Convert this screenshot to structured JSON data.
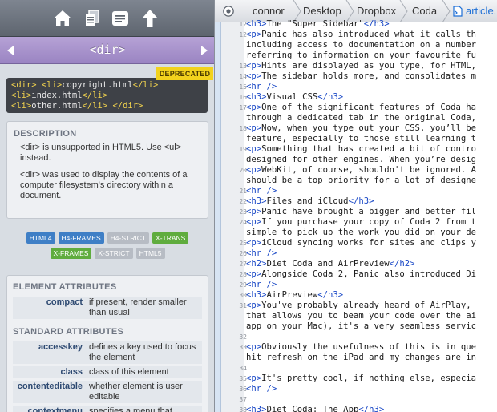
{
  "sidebar": {
    "toolbar": [
      "home-icon",
      "copy-icon",
      "list-icon",
      "up-arrow-icon"
    ],
    "title": "<dir>",
    "badge": "DEPRECATED",
    "example_lines": [
      [
        {
          "t": "tag",
          "v": "<dir>"
        },
        {
          "t": "txt",
          "v": " "
        },
        {
          "t": "tag",
          "v": "<li>"
        },
        {
          "t": "txt",
          "v": "copyright.html"
        },
        {
          "t": "tag",
          "v": "</li>"
        }
      ],
      [
        {
          "t": "tag",
          "v": "<li>"
        },
        {
          "t": "txt",
          "v": "index.html"
        },
        {
          "t": "tag",
          "v": "</li>"
        }
      ],
      [
        {
          "t": "tag",
          "v": "<li>"
        },
        {
          "t": "txt",
          "v": "other.html"
        },
        {
          "t": "tag",
          "v": "</li>"
        },
        {
          "t": "txt",
          "v": " "
        },
        {
          "t": "tag",
          "v": "</dir>"
        }
      ]
    ],
    "description": {
      "title": "DESCRIPTION",
      "paragraphs": [
        "<dir> is unsupported in HTML5. Use <ul> instead.",
        "<dir> was used to display the contents of a computer filesystem's directory within a document."
      ]
    },
    "spec_tags": [
      [
        {
          "label": "HTML4",
          "color": "blue"
        },
        {
          "label": "H4-FRAMES",
          "color": "blue"
        },
        {
          "label": "H4-STRICT",
          "color": "gray"
        },
        {
          "label": "X-TRANS",
          "color": "green"
        }
      ],
      [
        {
          "label": "X-FRAMES",
          "color": "green"
        },
        {
          "label": "X-STRICT",
          "color": "gray"
        },
        {
          "label": "HTML5",
          "color": "gray"
        }
      ]
    ],
    "element_attributes": {
      "title": "ELEMENT ATTRIBUTES",
      "items": [
        {
          "name": "compact",
          "desc": "if present, render smaller than usual"
        }
      ]
    },
    "standard_attributes": {
      "title": "STANDARD ATTRIBUTES",
      "items": [
        {
          "name": "accesskey",
          "desc": "defines a key used to focus the element"
        },
        {
          "name": "class",
          "desc": "class of this element"
        },
        {
          "name": "contenteditable",
          "desc": "whether element is user editable"
        },
        {
          "name": "contextmenu",
          "desc": "specifies a menu that"
        }
      ]
    }
  },
  "pathbar": {
    "root_icon": "disclosure-circle-icon",
    "crumbs": [
      "connor",
      "Desktop",
      "Dropbox",
      "Coda"
    ],
    "file": "article.ht"
  },
  "editor": {
    "lines": [
      {
        "n": "12",
        "segs": [
          {
            "t": "t",
            "v": "<h3>"
          },
          {
            "t": "x",
            "v": "The \"Super Sidebar\""
          },
          {
            "t": "t",
            "v": "</h3>"
          }
        ]
      },
      {
        "n": "12",
        "segs": [
          {
            "t": "t",
            "v": "<p>"
          },
          {
            "t": "x",
            "v": "Panic has also introduced what it calls th"
          }
        ]
      },
      {
        "n": "",
        "segs": [
          {
            "t": "x",
            "v": "including access to documentation on a number"
          }
        ]
      },
      {
        "n": "",
        "segs": [
          {
            "t": "x",
            "v": "referring to information on your favourite fu"
          }
        ]
      },
      {
        "n": "13",
        "segs": [
          {
            "t": "t",
            "v": "<p>"
          },
          {
            "t": "x",
            "v": "Hints are displayed as you type, for HTML,"
          }
        ]
      },
      {
        "n": "14",
        "segs": [
          {
            "t": "t",
            "v": "<p>"
          },
          {
            "t": "x",
            "v": "The sidebar holds more, and consolidates m"
          }
        ]
      },
      {
        "n": "15",
        "segs": [
          {
            "t": "t",
            "v": "<hr />"
          }
        ]
      },
      {
        "n": "16",
        "segs": [
          {
            "t": "t",
            "v": "<h3>"
          },
          {
            "t": "x",
            "v": "Visual CSS"
          },
          {
            "t": "t",
            "v": "</h3>"
          }
        ]
      },
      {
        "n": "17",
        "segs": [
          {
            "t": "t",
            "v": "<p>"
          },
          {
            "t": "x",
            "v": "One of the significant features of Coda ha"
          }
        ]
      },
      {
        "n": "",
        "segs": [
          {
            "t": "x",
            "v": "through a dedicated tab in the original Coda,"
          }
        ]
      },
      {
        "n": "18",
        "segs": [
          {
            "t": "t",
            "v": "<p>"
          },
          {
            "t": "x",
            "v": "Now, when you type out your CSS, you’ll be"
          }
        ]
      },
      {
        "n": "",
        "segs": [
          {
            "t": "x",
            "v": "feature, especially to those still learning t"
          }
        ]
      },
      {
        "n": "19",
        "segs": [
          {
            "t": "t",
            "v": "<p>"
          },
          {
            "t": "x",
            "v": "Something that has created a bit of contro"
          }
        ]
      },
      {
        "n": "",
        "segs": [
          {
            "t": "x",
            "v": "designed for other engines. When you’re desig"
          }
        ]
      },
      {
        "n": "20",
        "segs": [
          {
            "t": "t",
            "v": "<p>"
          },
          {
            "t": "x",
            "v": "WebKit, of course, shouldn't be ignored. A"
          }
        ]
      },
      {
        "n": "",
        "segs": [
          {
            "t": "x",
            "v": "should be a top priority for a lot of designe"
          }
        ]
      },
      {
        "n": "21",
        "segs": [
          {
            "t": "t",
            "v": "<hr />"
          }
        ]
      },
      {
        "n": "22",
        "segs": [
          {
            "t": "t",
            "v": "<h3>"
          },
          {
            "t": "x",
            "v": "Files and iCloud"
          },
          {
            "t": "t",
            "v": "</h3>"
          }
        ]
      },
      {
        "n": "23",
        "segs": [
          {
            "t": "t",
            "v": "<p>"
          },
          {
            "t": "x",
            "v": "Panic have brought a bigger and better fil"
          }
        ]
      },
      {
        "n": "24",
        "segs": [
          {
            "t": "t",
            "v": "<p>"
          },
          {
            "t": "x",
            "v": "If you purchase your copy of Coda 2 from t"
          }
        ]
      },
      {
        "n": "",
        "segs": [
          {
            "t": "x",
            "v": "simple to pick up the work you did on your de"
          }
        ]
      },
      {
        "n": "25",
        "segs": [
          {
            "t": "t",
            "v": "<p>"
          },
          {
            "t": "x",
            "v": "iCloud syncing works for sites and clips y"
          }
        ]
      },
      {
        "n": "26",
        "segs": [
          {
            "t": "t",
            "v": "<hr />"
          }
        ]
      },
      {
        "n": "27",
        "segs": [
          {
            "t": "t",
            "v": "<h2>"
          },
          {
            "t": "x",
            "v": "Diet Coda and AirPreview"
          },
          {
            "t": "t",
            "v": "</h2>"
          }
        ]
      },
      {
        "n": "28",
        "segs": [
          {
            "t": "t",
            "v": "<p>"
          },
          {
            "t": "x",
            "v": "Alongside Coda 2, Panic also introduced Di"
          }
        ]
      },
      {
        "n": "29",
        "segs": [
          {
            "t": "t",
            "v": "<hr />"
          }
        ]
      },
      {
        "n": "30",
        "segs": [
          {
            "t": "t",
            "v": "<h3>"
          },
          {
            "t": "x",
            "v": "AirPreview"
          },
          {
            "t": "t",
            "v": "</h3>"
          }
        ]
      },
      {
        "n": "31",
        "segs": [
          {
            "t": "t",
            "v": "<p>"
          },
          {
            "t": "x",
            "v": "You've probably already heard of AirPlay, "
          }
        ]
      },
      {
        "n": "",
        "segs": [
          {
            "t": "x",
            "v": "that allows you to beam your code over the ai"
          }
        ]
      },
      {
        "n": "",
        "segs": [
          {
            "t": "x",
            "v": "app on your Mac), it's a very seamless servic"
          }
        ]
      },
      {
        "n": "32",
        "segs": []
      },
      {
        "n": "33",
        "segs": [
          {
            "t": "t",
            "v": "<p>"
          },
          {
            "t": "x",
            "v": "Obviously the usefulness of this is in que"
          }
        ]
      },
      {
        "n": "",
        "segs": [
          {
            "t": "x",
            "v": "hit refresh on the iPad and my changes are in"
          }
        ]
      },
      {
        "n": "34",
        "segs": []
      },
      {
        "n": "35",
        "segs": [
          {
            "t": "t",
            "v": "<p>"
          },
          {
            "t": "x",
            "v": "It's pretty cool, if nothing else, especia"
          }
        ]
      },
      {
        "n": "36",
        "segs": [
          {
            "t": "t",
            "v": "<hr />"
          }
        ]
      },
      {
        "n": "37",
        "segs": []
      },
      {
        "n": "38",
        "segs": [
          {
            "t": "t",
            "v": "<h3>"
          },
          {
            "t": "x",
            "v": "Diet Coda: The App"
          },
          {
            "t": "t",
            "v": "</h3>"
          }
        ]
      }
    ]
  }
}
